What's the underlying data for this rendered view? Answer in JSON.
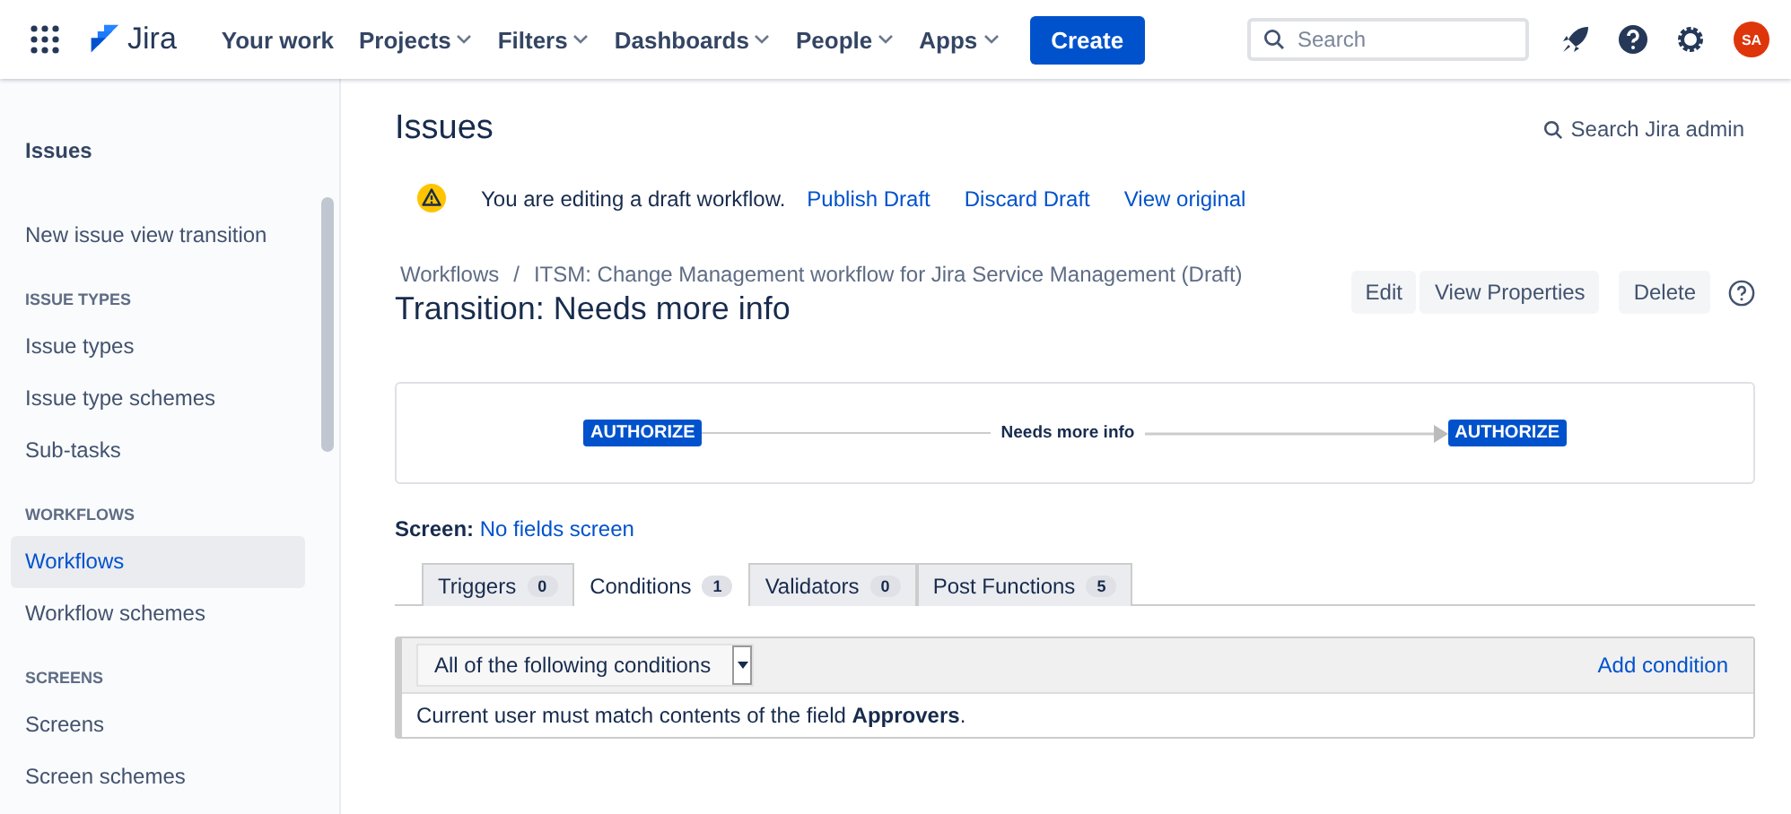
{
  "topnav": {
    "product": "Jira",
    "items": [
      {
        "label": "Your work",
        "dropdown": false
      },
      {
        "label": "Projects",
        "dropdown": true
      },
      {
        "label": "Filters",
        "dropdown": true
      },
      {
        "label": "Dashboards",
        "dropdown": true
      },
      {
        "label": "People",
        "dropdown": true
      },
      {
        "label": "Apps",
        "dropdown": true
      }
    ],
    "create": "Create",
    "search": {
      "placeholder": "Search"
    },
    "avatar": "SA"
  },
  "sidebar": {
    "title": "Issues",
    "items": [
      {
        "kind": "link",
        "label": "New issue view transition",
        "selected": false
      },
      {
        "kind": "section",
        "label": "ISSUE TYPES"
      },
      {
        "kind": "link",
        "label": "Issue types",
        "selected": false
      },
      {
        "kind": "link",
        "label": "Issue type schemes",
        "selected": false
      },
      {
        "kind": "link",
        "label": "Sub-tasks",
        "selected": false
      },
      {
        "kind": "section",
        "label": "WORKFLOWS"
      },
      {
        "kind": "link",
        "label": "Workflows",
        "selected": true
      },
      {
        "kind": "link",
        "label": "Workflow schemes",
        "selected": false
      },
      {
        "kind": "section",
        "label": "SCREENS"
      },
      {
        "kind": "link",
        "label": "Screens",
        "selected": false
      },
      {
        "kind": "link",
        "label": "Screen schemes",
        "selected": false
      }
    ]
  },
  "page": {
    "title": "Issues",
    "admin_search": "Search Jira admin",
    "banner": {
      "message": "You are editing a draft workflow.",
      "links": [
        "Publish Draft",
        "Discard Draft",
        "View original"
      ]
    },
    "breadcrumb_separator": "/",
    "breadcrumbs": [
      "Workflows",
      "ITSM: Change Management workflow for Jira Service Management (Draft)"
    ],
    "heading": "Transition: Needs more info",
    "actions": [
      "Edit",
      "View Properties",
      "Delete"
    ],
    "diagram": {
      "from": "AUTHORIZE",
      "transition": "Needs more info",
      "to": "AUTHORIZE"
    },
    "screen": {
      "label": "Screen:",
      "value": "No fields screen"
    },
    "tabs": [
      {
        "label": "Triggers",
        "count": "0",
        "selected": false
      },
      {
        "label": "Conditions",
        "count": "1",
        "selected": true
      },
      {
        "label": "Validators",
        "count": "0",
        "selected": false
      },
      {
        "label": "Post Functions",
        "count": "5",
        "selected": false
      }
    ],
    "conditions": {
      "select": "All of the following conditions",
      "add": "Add condition",
      "rows": [
        "Current user must match contents of the field **Approvers**."
      ]
    }
  }
}
